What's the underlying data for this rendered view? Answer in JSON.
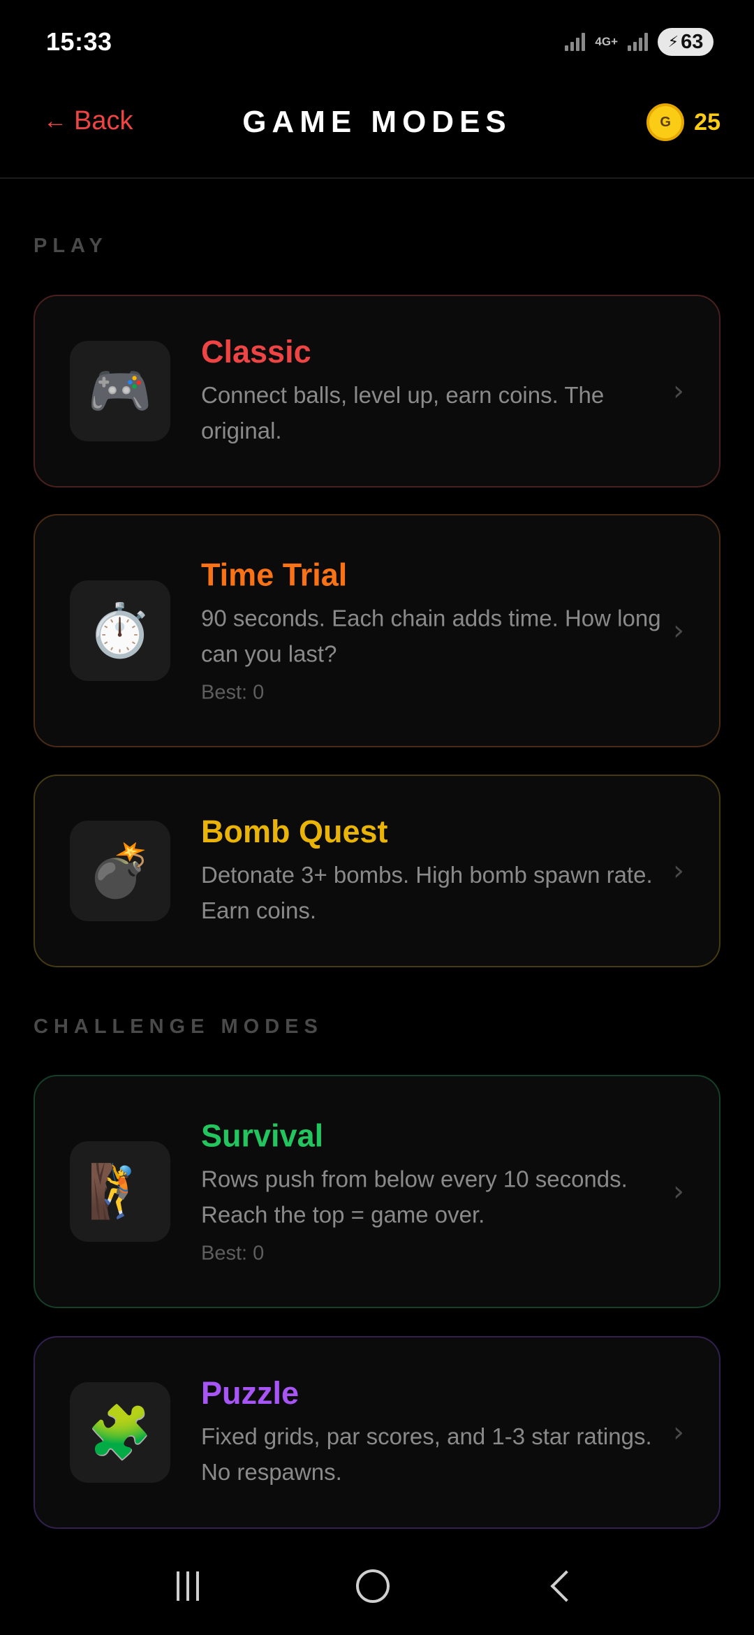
{
  "status_bar": {
    "time": "15:33",
    "network": "4G+",
    "battery": "63"
  },
  "header": {
    "back_label": "Back",
    "back_arrow": "←",
    "title": "GAME MODES",
    "coin_symbol": "G",
    "coin_count": "25"
  },
  "sections": {
    "play_label": "PLAY",
    "challenge_label": "CHALLENGE MODES"
  },
  "modes": [
    {
      "title": "Classic",
      "description": "Connect balls, level up, earn coins. The original.",
      "icon": "🎮",
      "icon_name": "gamepad-icon",
      "color": "#ef4444",
      "border": "#4a1f1f"
    },
    {
      "title": "Time Trial",
      "description": "90 seconds. Each chain adds time. How long can you last?",
      "best": "Best: 0",
      "icon": "⏱️",
      "icon_name": "stopwatch-icon",
      "color": "#f97316",
      "border": "#4a2a14"
    },
    {
      "title": "Bomb Quest",
      "description": "Detonate 3+ bombs. High bomb spawn rate. Earn coins.",
      "icon": "💣",
      "icon_name": "bomb-icon",
      "color": "#eab308",
      "border": "#453a12"
    },
    {
      "title": "Survival",
      "description": "Rows push from below every 10 seconds. Reach the top = game over.",
      "best": "Best: 0",
      "icon": "🧗",
      "icon_name": "climber-icon",
      "color": "#22c55e",
      "border": "#14402a"
    },
    {
      "title": "Puzzle",
      "description": "Fixed grids, par scores, and 1-3 star ratings. No respawns.",
      "icon": "🧩",
      "icon_name": "puzzle-piece-icon",
      "color": "#a855f7",
      "border": "#332050"
    }
  ],
  "chevron": "›"
}
